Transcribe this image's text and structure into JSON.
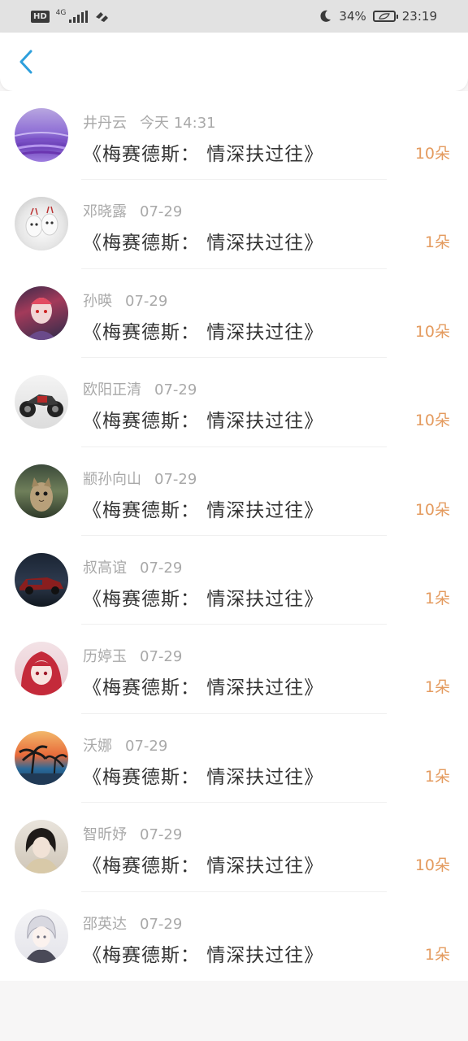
{
  "status_bar": {
    "hd": "HD",
    "network": "4G",
    "battery_percent": "34%",
    "time": "23:19"
  },
  "header": {
    "back_icon": "chevron-left-icon"
  },
  "colors": {
    "accent": "#2d9fdc",
    "count": "#e49b5f",
    "meta": "#a9a9a9"
  },
  "gifts": [
    {
      "name": "井丹云",
      "time": "今天 14:31",
      "message": "《梅赛德斯： 情深扶过往》",
      "count": "10朵"
    },
    {
      "name": "邓晓露",
      "time": "07-29",
      "message": "《梅赛德斯： 情深扶过往》",
      "count": "1朵"
    },
    {
      "name": "孙暎",
      "time": "07-29",
      "message": "《梅赛德斯： 情深扶过往》",
      "count": "10朵"
    },
    {
      "name": "欧阳正清",
      "time": "07-29",
      "message": "《梅赛德斯： 情深扶过往》",
      "count": "10朵"
    },
    {
      "name": "颛孙向山",
      "time": "07-29",
      "message": "《梅赛德斯： 情深扶过往》",
      "count": "10朵"
    },
    {
      "name": "叔高谊",
      "time": "07-29",
      "message": "《梅赛德斯： 情深扶过往》",
      "count": "1朵"
    },
    {
      "name": "历婷玉",
      "time": "07-29",
      "message": "《梅赛德斯： 情深扶过往》",
      "count": "1朵"
    },
    {
      "name": "沃娜",
      "time": "07-29",
      "message": "《梅赛德斯： 情深扶过往》",
      "count": "1朵"
    },
    {
      "name": "智昕妤",
      "time": "07-29",
      "message": "《梅赛德斯： 情深扶过往》",
      "count": "10朵"
    },
    {
      "name": "邵英达",
      "time": "07-29",
      "message": "《梅赛德斯： 情深扶过往》",
      "count": "1朵"
    }
  ]
}
